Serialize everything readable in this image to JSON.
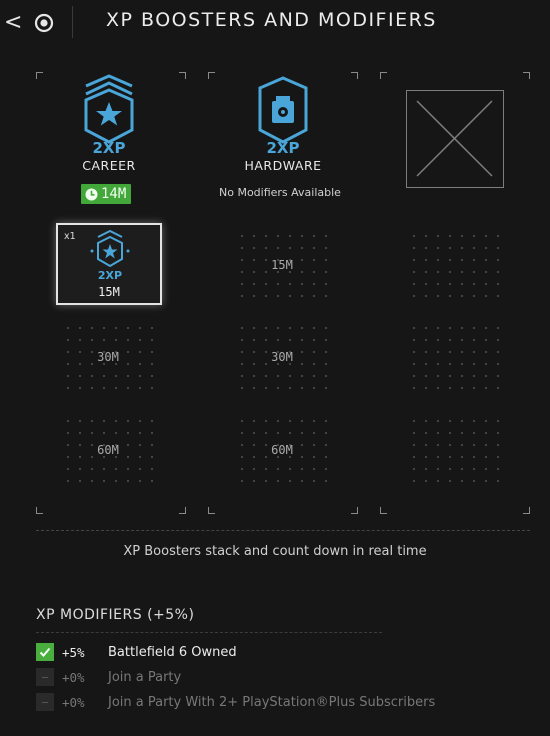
{
  "header": {
    "back_glyph": "<",
    "title": "XP BOOSTERS AND MODIFIERS"
  },
  "boosters": [
    {
      "icon": "career-xp-icon",
      "badge": "2XP",
      "label": "CAREER",
      "timer": "14M",
      "timer_color": "#43a83a"
    },
    {
      "icon": "hardware-xp-icon",
      "badge": "2XP",
      "label": "HARDWARE",
      "status": "No Modifiers Available"
    },
    {
      "icon": "empty-slot-icon"
    }
  ],
  "career_slots": {
    "active": {
      "count": "x1",
      "badge": "2XP",
      "label": "15M"
    },
    "empty": [
      "30M",
      "60M"
    ]
  },
  "hardware_slots": [
    "15M",
    "30M",
    "60M"
  ],
  "info_text": "XP Boosters stack and count down in real time",
  "modifiers": {
    "title": "XP MODIFIERS (+5%)",
    "items": [
      {
        "checked": true,
        "pct": "+5%",
        "label": "Battlefield 6 Owned"
      },
      {
        "checked": false,
        "pct": "+0%",
        "label": "Join a Party"
      },
      {
        "checked": false,
        "pct": "+0%",
        "label": "Join a Party With 2+ PlayStation®Plus Subscribers"
      }
    ]
  },
  "colors": {
    "accent_blue": "#4aa6d8",
    "active_green": "#43a83a"
  }
}
